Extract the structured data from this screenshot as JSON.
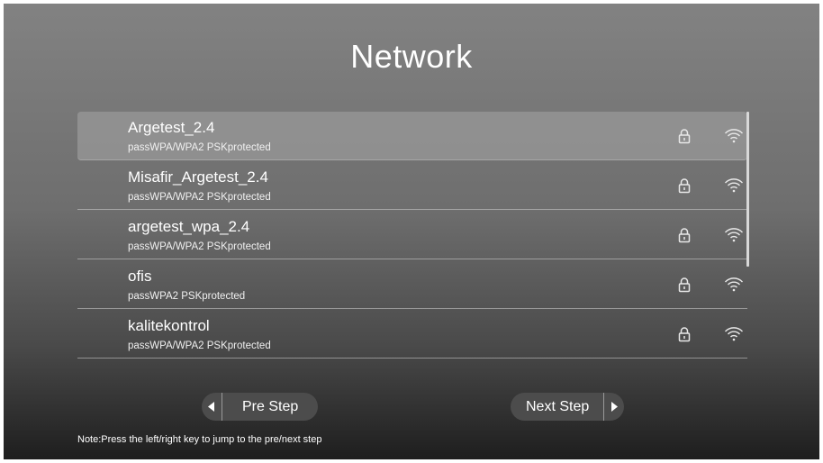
{
  "page": {
    "title": "Network"
  },
  "networks": [
    {
      "name": "Argetest_2.4",
      "security": "passWPA/WPA2 PSKprotected",
      "lock_icon": "lock-icon",
      "signal_icon": "wifi-icon",
      "selected": true
    },
    {
      "name": "Misafir_Argetest_2.4",
      "security": "passWPA/WPA2 PSKprotected",
      "lock_icon": "lock-icon",
      "signal_icon": "wifi-icon",
      "selected": false
    },
    {
      "name": "argetest_wpa_2.4",
      "security": "passWPA/WPA2 PSKprotected",
      "lock_icon": "lock-icon",
      "signal_icon": "wifi-icon",
      "selected": false
    },
    {
      "name": "ofis",
      "security": "passWPA2 PSKprotected",
      "lock_icon": "lock-icon",
      "signal_icon": "wifi-icon",
      "selected": false
    },
    {
      "name": "kalitekontrol",
      "security": "passWPA/WPA2 PSKprotected",
      "lock_icon": "lock-icon",
      "signal_icon": "wifi-icon",
      "selected": false
    }
  ],
  "buttons": {
    "pre_step": "Pre Step",
    "next_step": "Next Step",
    "pre_icon": "arrow-left-icon",
    "next_icon": "arrow-right-icon"
  },
  "note": "Note:Press the left/right key to jump to the pre/next step",
  "colors": {
    "text": "#ffffff",
    "button_bg": "#4c4c4c",
    "selected_row": "#a5a5a5"
  }
}
